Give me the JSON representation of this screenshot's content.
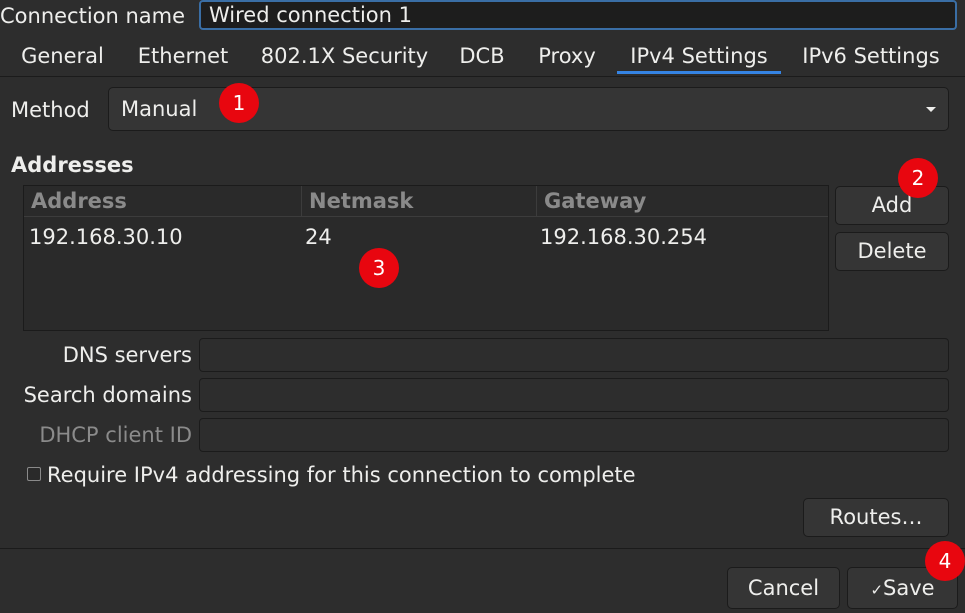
{
  "connection": {
    "label": "Connection name",
    "value": "Wired connection 1"
  },
  "tabs": [
    {
      "label": "General"
    },
    {
      "label": "Ethernet"
    },
    {
      "label": "802.1X Security"
    },
    {
      "label": "DCB"
    },
    {
      "label": "Proxy"
    },
    {
      "label": "IPv4 Settings",
      "active": true
    },
    {
      "label": "IPv6 Settings"
    }
  ],
  "method": {
    "label": "Method",
    "value": "Manual"
  },
  "addresses": {
    "heading": "Addresses",
    "columns": [
      "Address",
      "Netmask",
      "Gateway"
    ],
    "rows": [
      [
        "192.168.30.10",
        "24",
        "192.168.30.254"
      ]
    ],
    "add_label": "Add",
    "delete_label": "Delete"
  },
  "fields": {
    "dns_label": "DNS servers",
    "search_label": "Search domains",
    "dhcp_label": "DHCP client ID"
  },
  "require_label": "Require IPv4 addressing for this connection to complete",
  "routes_label": "Routes…",
  "footer": {
    "cancel_label": "Cancel",
    "save_label": "Save"
  },
  "badges": [
    "1",
    "2",
    "3",
    "4"
  ],
  "colors": {
    "accent": "#3584e4",
    "badge": "#e8060f",
    "background": "#2d2d2d"
  }
}
